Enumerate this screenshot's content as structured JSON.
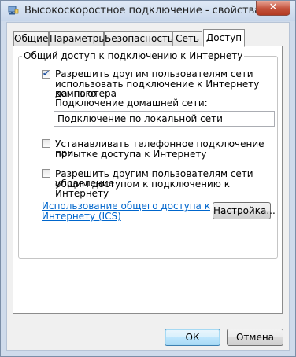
{
  "window": {
    "title": "Высокоскоростное подключение - свойства",
    "close_glyph": "✕"
  },
  "tabs": [
    {
      "label": "Общие",
      "active": false
    },
    {
      "label": "Параметры",
      "active": false
    },
    {
      "label": "Безопасность",
      "active": false
    },
    {
      "label": "Сеть",
      "active": false
    },
    {
      "label": "Доступ",
      "active": true
    }
  ],
  "sharing": {
    "group_title": "Общий доступ к подключению к Интернету",
    "allow_sharing": {
      "checked": true,
      "line1": "Разрешить другим пользователям сети",
      "line2": "использовать подключение к Интернету данного",
      "line3": "компьютера"
    },
    "home_network_label": "Подключение домашней сети:",
    "home_network_value": "Подключение по локальной сети",
    "dial_on_demand": {
      "checked": false,
      "line1": "Устанавливать телефонное подключение при",
      "line2": "попытке доступа к Интернету"
    },
    "allow_control": {
      "checked": false,
      "line1": "Разрешить другим пользователям сети управление",
      "line2": "общим доступом к подключению к Интернету"
    },
    "ics_link_line1": "Использование общего доступа к",
    "ics_link_line2": "Интернету (ICS)",
    "settings_button": "Настройка..."
  },
  "footer": {
    "ok": "ОК",
    "cancel": "Отмена"
  }
}
